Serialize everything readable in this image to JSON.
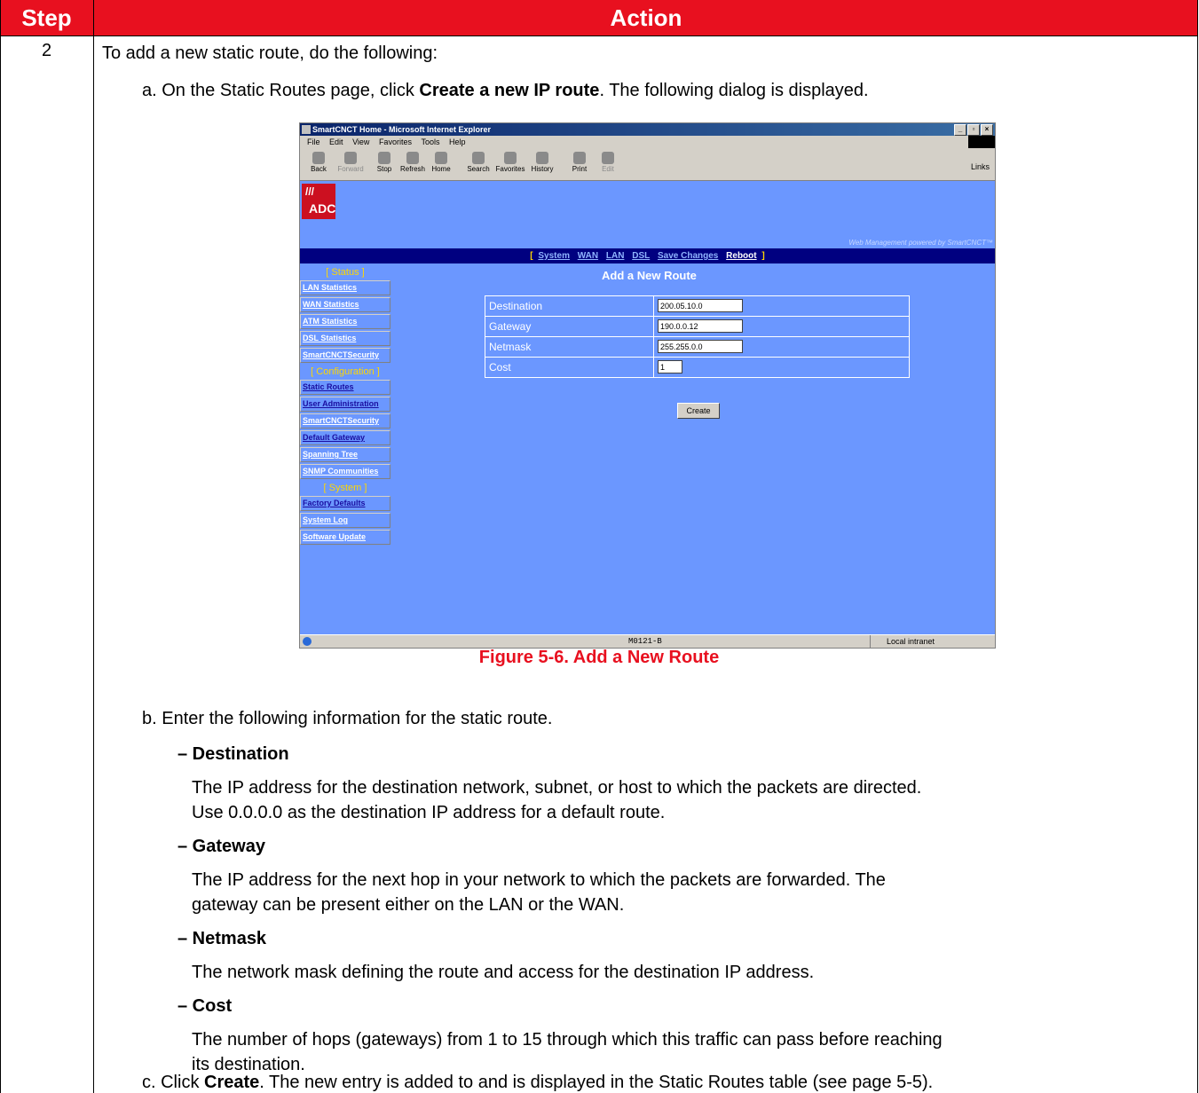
{
  "header": {
    "step": "Step",
    "action": "Action"
  },
  "step_number": "2",
  "intro": "To add a new static route, do the following:",
  "step_a": {
    "prefix": "a. On the Static Routes page, click ",
    "bold": "Create a new IP route",
    "suffix": ". The following dialog is displayed."
  },
  "screenshot": {
    "window_title": "SmartCNCT Home - Microsoft Internet Explorer",
    "menu": [
      "File",
      "Edit",
      "View",
      "Favorites",
      "Tools",
      "Help"
    ],
    "toolbar": [
      "Back",
      "Forward",
      "Stop",
      "Refresh",
      "Home",
      "Search",
      "Favorites",
      "History",
      "Print",
      "Edit"
    ],
    "links": "Links",
    "logo": "ADC",
    "powered_by": "Web Management powered by SmartCNCT™",
    "nav": [
      "System",
      "WAN",
      "LAN",
      "DSL",
      "Save Changes",
      "Reboot"
    ],
    "sidebar": {
      "status_heading": "[ Status ]",
      "status_items": [
        "LAN Statistics",
        "WAN Statistics",
        "ATM Statistics",
        "DSL Statistics",
        "SmartCNCTSecurity"
      ],
      "config_heading": "[ Configuration ]",
      "config_items": [
        "Static Routes",
        "User Administration",
        "SmartCNCTSecurity",
        "Default Gateway",
        "Spanning Tree",
        "SNMP Communities"
      ],
      "system_heading": "[ System ]",
      "system_items": [
        "Factory Defaults",
        "System Log",
        "Software Update"
      ]
    },
    "page_heading": "Add a New Route",
    "form": {
      "destination_label": "Destination",
      "destination_value": "200.05.10.0",
      "gateway_label": "Gateway",
      "gateway_value": "190.0.0.12",
      "netmask_label": "Netmask",
      "netmask_value": "255.255.0.0",
      "cost_label": "Cost",
      "cost_value": "1",
      "create_button": "Create"
    },
    "status_code": "M0121-B",
    "zone": "Local intranet"
  },
  "figure_caption": "Figure 5-6. Add a New Route",
  "step_b": "b. Enter the following information for the static route.",
  "fields": {
    "destination_title": "– Destination",
    "destination_line1": "The IP address for the destination network, subnet, or host to which the packets are directed.",
    "destination_line2": "Use 0.0.0.0 as the destination IP address for a default route.",
    "gateway_title": "– Gateway",
    "gateway_line1": "The IP address for the next hop in your network to which the packets are forwarded. The",
    "gateway_line2": "gateway can be present either on the LAN or the WAN.",
    "netmask_title": "– Netmask",
    "netmask_line1": "The network mask defining the route and access for the destination IP address.",
    "cost_title": "– Cost",
    "cost_line1": "The number of hops (gateways) from 1 to 15 through which this traffic can pass before reaching",
    "cost_line2": "its destination."
  },
  "step_c": {
    "prefix": "c. Click ",
    "bold": "Create",
    "suffix": ". The new entry is added to and is displayed in the Static Routes table (see page 5-5)."
  }
}
